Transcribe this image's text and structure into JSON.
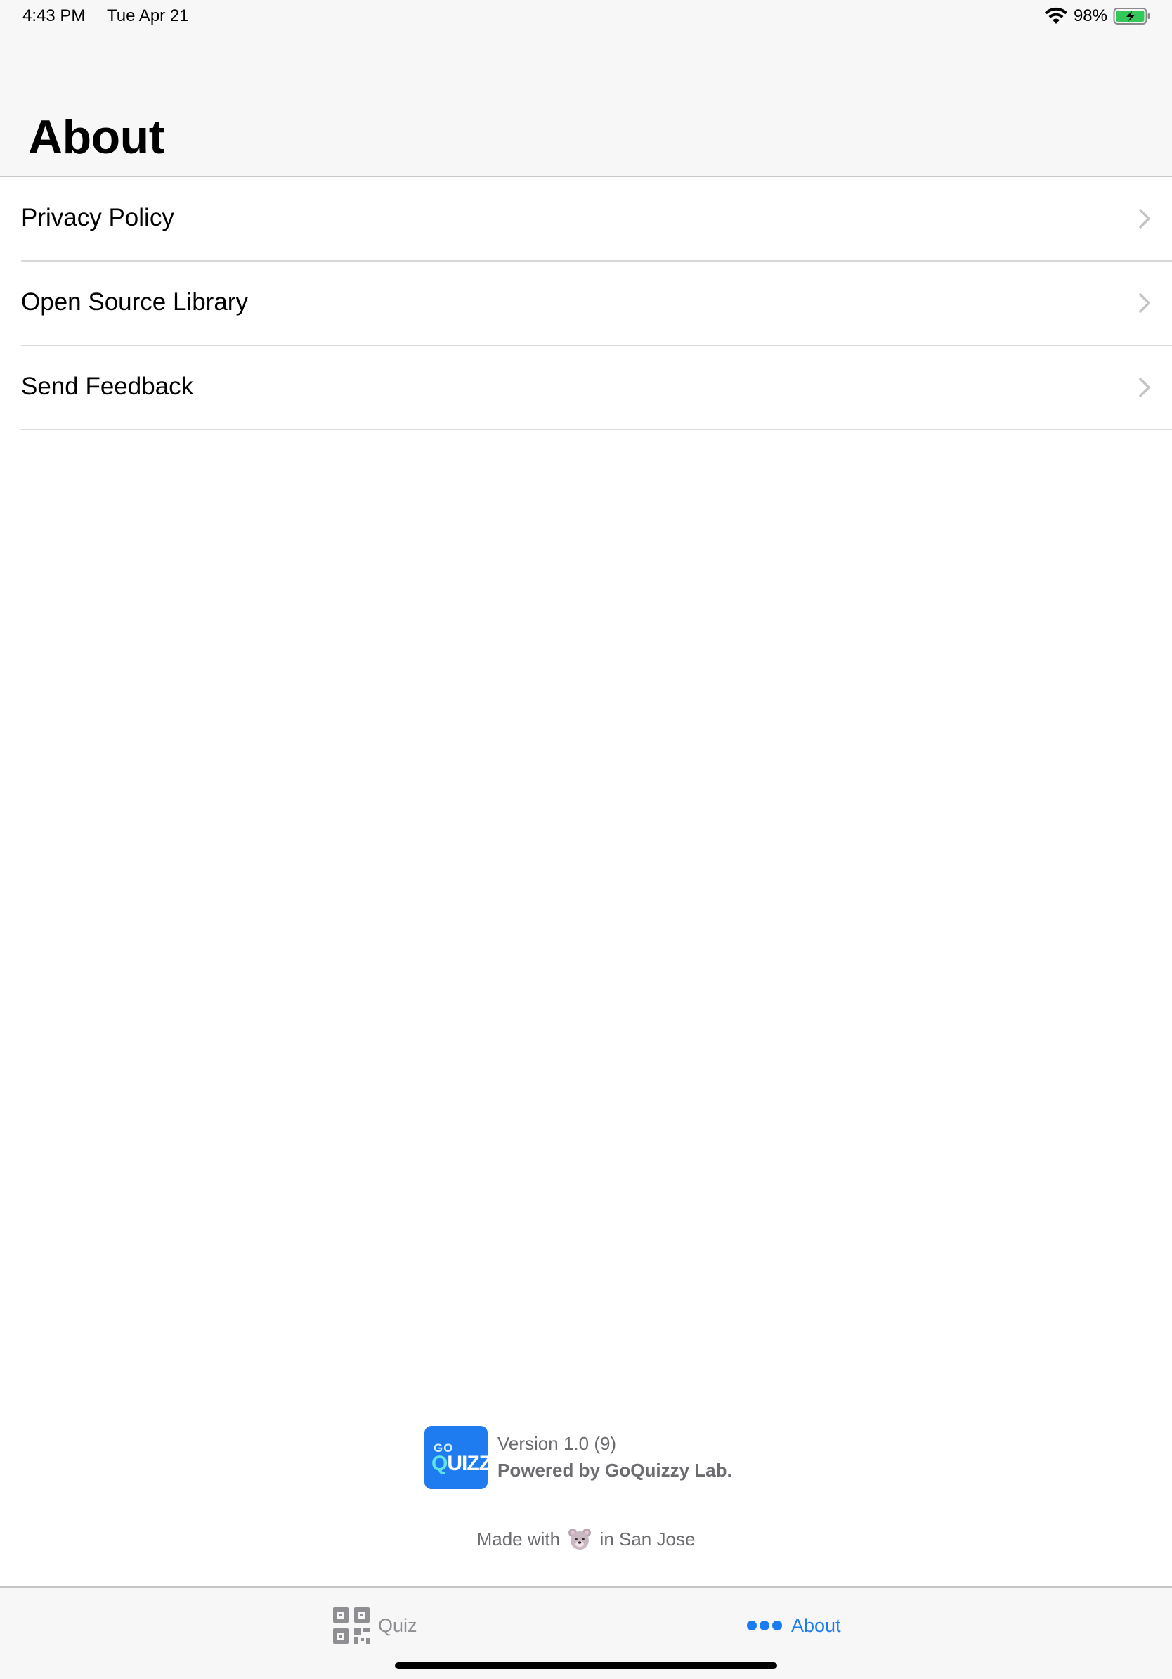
{
  "status_bar": {
    "time": "4:43 PM",
    "date": "Tue Apr 21",
    "battery_percent": "98%",
    "wifi_icon": "wifi-icon",
    "battery_icon": "battery-charging-icon"
  },
  "header": {
    "title": "About"
  },
  "list": {
    "items": [
      {
        "label": "Privacy Policy",
        "icon": "chevron-right-icon"
      },
      {
        "label": "Open Source Library",
        "icon": "chevron-right-icon"
      },
      {
        "label": "Send Feedback",
        "icon": "chevron-right-icon"
      }
    ]
  },
  "footer": {
    "logo": {
      "line1": "GO",
      "line2": "QUIZZY"
    },
    "version": "Version 1.0 (9)",
    "powered_by": "Powered by GoQuizzy Lab.",
    "made_with_prefix": "Made with",
    "made_with_emoji": "bear-emoji",
    "made_with_suffix": "in San Jose"
  },
  "tab_bar": {
    "tabs": [
      {
        "label": "Quiz",
        "icon": "qr-code-icon",
        "selected": false
      },
      {
        "label": "About",
        "icon": "more-dots-icon",
        "selected": true
      }
    ]
  },
  "colors": {
    "accent": "#1a7cf0",
    "logo_background": "#1e7cf0",
    "secondary_text": "#6b6b70",
    "inactive_tab": "#8e8e93"
  }
}
